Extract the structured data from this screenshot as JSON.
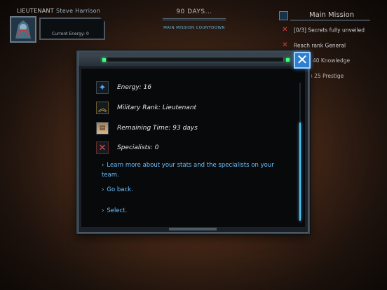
{
  "hud": {
    "rank": "LIEUTENANT",
    "player_name": "Steve Harrison",
    "energy_label": "Current Energy: 0"
  },
  "countdown": {
    "days_text": "90 DAYS...",
    "label": "MAIN MISSION COUNTDOWN"
  },
  "mission": {
    "title": "Main Mission",
    "items": [
      {
        "text": "[0/3] Secrets fully unveiled",
        "status": "failed"
      },
      {
        "text": "Reach rank General",
        "status": "failed"
      },
      {
        "text": "40 Knowledge",
        "status": "pending"
      },
      {
        "text": "n 25 Prestige",
        "status": "pending"
      }
    ]
  },
  "dialog": {
    "close_glyph": "✕",
    "stats": [
      {
        "icon": "energy-icon",
        "label": "Energy: 16"
      },
      {
        "icon": "rank-chevron-icon",
        "label": "Military Rank: Lieutenant"
      },
      {
        "icon": "calendar-icon",
        "label": "Remaining Time: 93 days"
      },
      {
        "icon": "specialists-icon",
        "label": "Specialists: 0"
      }
    ],
    "options": [
      "Learn more about your stats and the specialists on your team.",
      "Go back.",
      "Select."
    ]
  },
  "colors": {
    "accent_blue": "#6cc0ff",
    "close_button": "#2f7fd1",
    "failed_red": "#e04040",
    "indicator_green": "#3cff7a"
  }
}
